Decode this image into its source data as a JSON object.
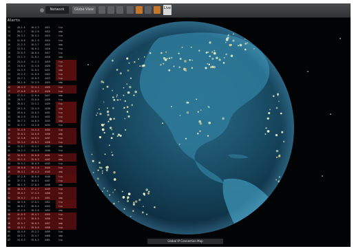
{
  "topbar": {
    "menu_label": "Network",
    "mode_label": "Globe View",
    "view_label": "Live"
  },
  "panel": {
    "title": "Alerts"
  },
  "caption": "Global IP Connection Map",
  "colors": {
    "ocean": "#1d5a78",
    "land": "#2e7897",
    "point": "#e8f3c8",
    "alert_row": "#8c1414",
    "accent": "#c4762b"
  },
  "rows": [
    [
      "12",
      "20.1.4",
      "10.2.3",
      "4411",
      "tcp"
    ],
    [
      "13",
      "20.1.7",
      "10.2.6",
      "4412",
      "udp"
    ],
    [
      "14",
      "20.3.1",
      "10.4.2",
      "4413",
      "tcp"
    ],
    [
      "15",
      "21.0.8",
      "10.1.9",
      "4414",
      "tcp"
    ],
    [
      "16",
      "21.2.5",
      "10.3.7",
      "4415",
      "udp"
    ],
    [
      "17",
      "22.4.1",
      "10.6.2",
      "4416",
      "tcp"
    ],
    [
      "18",
      "22.6.3",
      "10.8.4",
      "4417",
      "tcp"
    ],
    [
      "19",
      "23.1.2",
      "11.0.1",
      "4418",
      "udp"
    ],
    [
      "20",
      "23.5.6",
      "11.2.3",
      "4419",
      "tcp"
    ],
    [
      "21",
      "24.0.4",
      "11.4.8",
      "4420",
      "tcp"
    ],
    [
      "22",
      "24.3.9",
      "11.6.2",
      "4421",
      "udp"
    ],
    [
      "23",
      "25.2.2",
      "11.8.5",
      "4422",
      "tcp"
    ],
    [
      "24",
      "25.7.1",
      "12.0.3",
      "4423",
      "tcp"
    ],
    [
      "25",
      "26.1.6",
      "12.2.9",
      "4424",
      "udp"
    ],
    [
      "26",
      "26.4.3",
      "12.4.1",
      "4425",
      "tcp"
    ],
    [
      "27",
      "27.0.8",
      "12.6.7",
      "4426",
      "tcp"
    ],
    [
      "28",
      "27.5.2",
      "12.8.4",
      "4427",
      "udp"
    ],
    [
      "29",
      "28.3.7",
      "13.0.6",
      "4428",
      "tcp"
    ],
    [
      "30",
      "28.8.1",
      "13.2.2",
      "4429",
      "tcp"
    ],
    [
      "31",
      "29.1.5",
      "13.4.9",
      "4430",
      "udp"
    ],
    [
      "32",
      "29.6.4",
      "13.6.3",
      "4431",
      "tcp"
    ],
    [
      "33",
      "30.2.9",
      "13.8.1",
      "4432",
      "tcp"
    ],
    [
      "34",
      "30.7.3",
      "14.0.5",
      "4433",
      "udp"
    ],
    [
      "35",
      "31.1.1",
      "14.2.8",
      "4434",
      "tcp"
    ],
    [
      "36",
      "31.4.6",
      "14.4.4",
      "4435",
      "tcp"
    ],
    [
      "37",
      "32.0.2",
      "14.6.6",
      "4436",
      "udp"
    ],
    [
      "38",
      "32.5.8",
      "14.8.2",
      "4437",
      "tcp"
    ],
    [
      "39",
      "33.3.4",
      "15.0.7",
      "4438",
      "tcp"
    ],
    [
      "40",
      "33.8.7",
      "15.2.1",
      "4439",
      "udp"
    ],
    [
      "41",
      "34.2.3",
      "15.4.5",
      "4440",
      "tcp"
    ],
    [
      "42",
      "34.6.9",
      "15.6.8",
      "4441",
      "tcp"
    ],
    [
      "43",
      "35.1.5",
      "15.8.3",
      "4442",
      "udp"
    ],
    [
      "44",
      "35.5.2",
      "16.0.9",
      "4443",
      "tcp"
    ],
    [
      "45",
      "36.0.6",
      "16.2.4",
      "4444",
      "tcp"
    ],
    [
      "46",
      "36.4.1",
      "16.4.2",
      "4445",
      "udp"
    ],
    [
      "47",
      "37.2.8",
      "16.6.6",
      "4446",
      "tcp"
    ],
    [
      "48",
      "37.7.4",
      "16.8.1",
      "4447",
      "tcp"
    ],
    [
      "49",
      "38.1.9",
      "17.0.3",
      "4448",
      "udp"
    ],
    [
      "50",
      "38.5.3",
      "17.2.7",
      "4449",
      "tcp"
    ],
    [
      "51",
      "39.0.7",
      "17.4.5",
      "4450",
      "tcp"
    ],
    [
      "52",
      "39.4.2",
      "17.6.9",
      "4451",
      "udp"
    ],
    [
      "53",
      "40.3.6",
      "17.8.2",
      "4452",
      "tcp"
    ],
    [
      "54",
      "40.8.1",
      "18.0.4",
      "4453",
      "tcp"
    ],
    [
      "55",
      "41.2.5",
      "18.2.8",
      "4454",
      "udp"
    ],
    [
      "56",
      "41.6.9",
      "18.4.1",
      "4455",
      "tcp"
    ],
    [
      "57",
      "42.1.3",
      "18.6.5",
      "4456",
      "tcp"
    ],
    [
      "58",
      "42.5.7",
      "18.8.3",
      "4457",
      "udp"
    ],
    [
      "59",
      "43.0.2",
      "19.0.6",
      "4458",
      "tcp"
    ],
    [
      "60",
      "43.4.6",
      "19.2.2",
      "4459",
      "tcp"
    ],
    [
      "61",
      "44.2.1",
      "19.4.7",
      "4460",
      "udp"
    ],
    [
      "62",
      "44.6.5",
      "19.6.3",
      "4461",
      "tcp"
    ]
  ]
}
